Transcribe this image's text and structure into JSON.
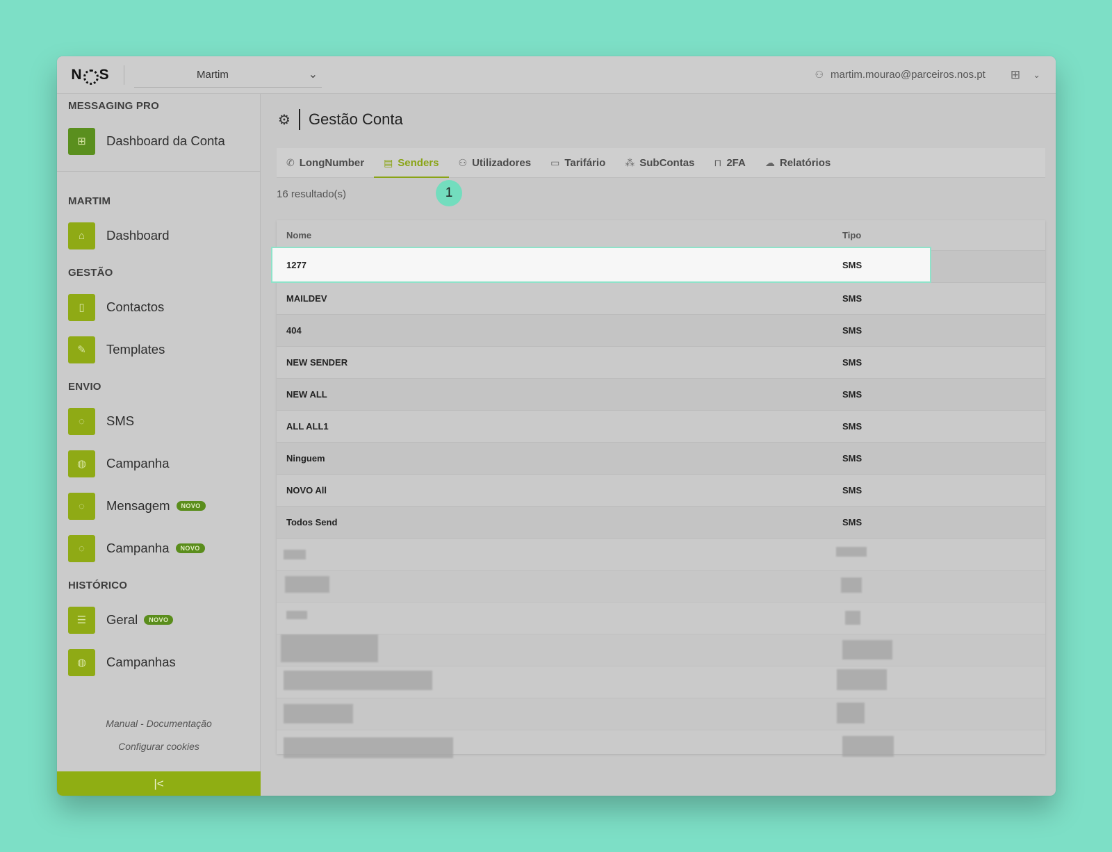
{
  "header": {
    "logo": "NOS",
    "account": "Martim",
    "user_email": "martim.mourao@parceiros.nos.pt"
  },
  "sidebar": {
    "brand_section": "MESSAGING PRO",
    "dashboard_conta": "Dashboard da Conta",
    "account_section": "MARTIM",
    "dashboard": "Dashboard",
    "gestao_section": "GESTÃO",
    "contactos": "Contactos",
    "templates": "Templates",
    "envio_section": "ENVIO",
    "sms": "SMS",
    "campanha": "Campanha",
    "mensagem": "Mensagem",
    "campanha_novo": "Campanha",
    "historico_section": "HISTÓRICO",
    "geral": "Geral",
    "campanhas": "Campanhas",
    "badge_novo": "NOVO",
    "manual_link": "Manual - Documentação",
    "cookies_link": "Configurar cookies"
  },
  "main": {
    "title": "Gestão Conta",
    "tabs": [
      {
        "label": "LongNumber",
        "icon": "phone-icon"
      },
      {
        "label": "Senders",
        "icon": "id-card-icon",
        "active": true
      },
      {
        "label": "Utilizadores",
        "icon": "users-icon"
      },
      {
        "label": "Tarifário",
        "icon": "wallet-icon"
      },
      {
        "label": "SubContas",
        "icon": "hierarchy-icon"
      },
      {
        "label": "2FA",
        "icon": "lock-icon"
      },
      {
        "label": "Relatórios",
        "icon": "cloud-icon"
      }
    ],
    "result_count": "16 resultado(s)",
    "step_marker": "1"
  },
  "table": {
    "columns": [
      "Nome",
      "Tipo"
    ],
    "rows": [
      [
        "1277",
        "SMS"
      ],
      [
        "MAILDEV",
        "SMS"
      ],
      [
        "404",
        "SMS"
      ],
      [
        "NEW SENDER",
        "SMS"
      ],
      [
        "NEW ALL",
        "SMS"
      ],
      [
        "ALL ALL1",
        "SMS"
      ],
      [
        "Ninguem",
        "SMS"
      ],
      [
        "NOVO All",
        "SMS"
      ],
      [
        "Todos Send",
        "SMS"
      ]
    ]
  },
  "colors": {
    "accent": "#8aa416",
    "highlight_border": "#8fe2c9",
    "background": "#7ddfc6"
  }
}
